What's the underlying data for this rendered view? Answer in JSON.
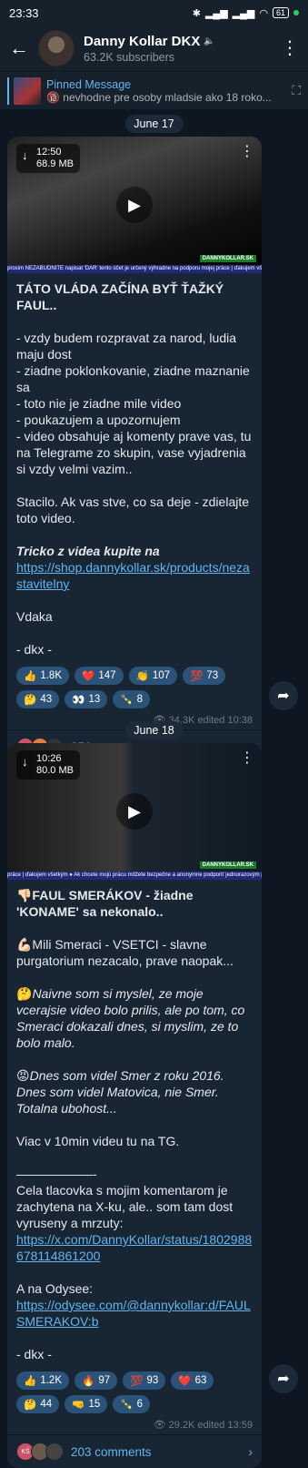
{
  "status": {
    "time": "23:33",
    "battery": "61"
  },
  "header": {
    "title": "Danny Kollar DKX",
    "subscribers": "63.2K subscribers"
  },
  "pinned": {
    "label": "Pinned Message",
    "text": "🔞 nevhodne pre osoby mladsie ako 18 roko..."
  },
  "dates": [
    "June 17",
    "June 18"
  ],
  "post1": {
    "video_time": "12:50",
    "video_size": "68.9 MB",
    "strip": "prosim NEZABUDNITE napisat 'DAR' tento účet je určený výhradne na podporu mojej práce | ďakujem všetkým",
    "watermark": "DANNYKOLLAR.SK",
    "title": "TÁTO VLÁDA ZAČÍNA BYŤ ŤAŽKÝ FAUL..",
    "lines": [
      "- vzdy budem rozpravat za narod, ludia maju dost",
      "- ziadne poklonkovanie, ziadne maznanie sa",
      "- toto nie je ziadne mile video",
      "- poukazujem a upozornujem",
      "- video obsahuje aj komenty prave vas, tu na Telegrame zo skupin, vase vyjadrenia si vzdy velmi vazim.."
    ],
    "para2": "Stacilo. Ak vas stve, co sa deje - zdielajte toto video.",
    "shop_label": "Tricko z videa kupite na",
    "shop_link": "https://shop.dannykollar.sk/products/nezastavitelny",
    "thanks": "Vdaka",
    "sign": "- dkx -",
    "reactions": [
      {
        "emoji": "👍",
        "count": "1.8K"
      },
      {
        "emoji": "❤️",
        "count": "147"
      },
      {
        "emoji": "👏",
        "count": "107"
      },
      {
        "emoji": "💯",
        "count": "73"
      },
      {
        "emoji": "🤔",
        "count": "43"
      },
      {
        "emoji": "👀",
        "count": "13"
      },
      {
        "emoji": "🍾",
        "count": "8"
      }
    ],
    "views": "👁 34.3K",
    "edited": "edited 10:38",
    "comments": "356 comments",
    "comment_avatars": [
      "MC",
      "A"
    ]
  },
  "post2": {
    "video_time": "10:26",
    "video_size": "80.0 MB",
    "strip": "práce | ďakujem všetkým   ● Ak chcete mojú prácu môžete bezpečne a anonymne podporiť jednorazovým príspevkom",
    "watermark": "DANNYKOLLAR.SK",
    "title": "👎🏻FAUL SMERÁKOV - žiadne 'KONAME' sa nekonalo..",
    "p1": "💪🏻Mili Smeraci - VSETCI - slavne purgatorium nezacalo, prave naopak...",
    "p2_emoji": "🤔",
    "p2": "Naivne som si myslel, ze moje vcerajsie video bolo prilis, ale po tom, co Smeraci dokazali dnes, si myslim, ze to bolo malo.",
    "p3_emoji": "😡",
    "p3": "Dnes som videl Smer z roku 2016. Dnes som videl Matovica, nie Smer. Totalna ubohost...",
    "p4": "Viac v 10min videu tu na TG.",
    "divider": "——————-",
    "p5": "Cela tlacovka s mojim komentarom je zachytena na X-ku, ale.. som tam dost vyruseny a mrzuty:",
    "x_link": "https://x.com/DannyKollar/status/1802988678114861200",
    "odysee_label": "A na Odysee:",
    "odysee_link": "https://odysee.com/@dannykollar:d/FAULSMERAKOV:b",
    "sign": "- dkx -",
    "reactions": [
      {
        "emoji": "👍",
        "count": "1.2K"
      },
      {
        "emoji": "🔥",
        "count": "97"
      },
      {
        "emoji": "💯",
        "count": "93"
      },
      {
        "emoji": "❤️",
        "count": "63"
      },
      {
        "emoji": "🤔",
        "count": "44"
      },
      {
        "emoji": "🤜",
        "count": "15"
      },
      {
        "emoji": "🍾",
        "count": "6"
      }
    ],
    "views": "👁 29.2K",
    "edited": "edited 13:59",
    "comments": "203 comments",
    "comment_avatars": [
      "KŠ",
      "",
      ""
    ]
  }
}
